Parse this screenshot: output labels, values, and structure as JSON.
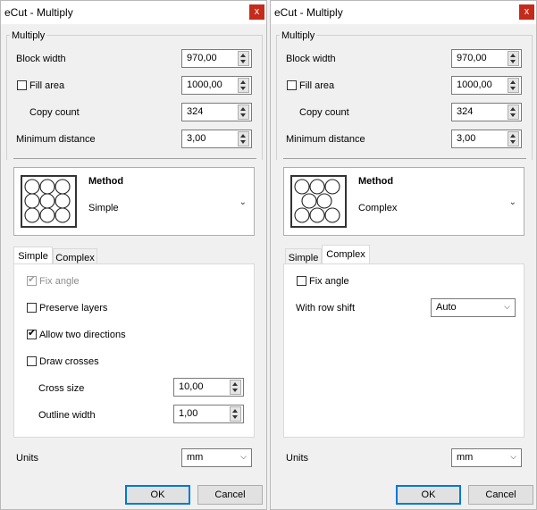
{
  "windows": [
    {
      "title": "eCut - Multiply",
      "close_label": "x",
      "group_label": "Multiply",
      "block_width_label": "Block width",
      "block_width_value": "970,00",
      "fill_area_label": "Fill area",
      "fill_area_value": "1000,00",
      "fill_area_checked": false,
      "copy_count_label": "Copy count",
      "copy_count_value": "324",
      "min_distance_label": "Minimum distance",
      "min_distance_value": "3,00",
      "method_title": "Method",
      "method_value": "Simple",
      "tabs": [
        "Simple",
        "Complex"
      ],
      "active_tab": "Simple",
      "simple_tab": {
        "fix_angle_label": "Fix angle",
        "fix_angle_checked": true,
        "fix_angle_disabled": true,
        "preserve_layers_label": "Preserve layers",
        "preserve_layers_checked": false,
        "allow_two_dir_label": "Allow two directions",
        "allow_two_dir_checked": true,
        "draw_crosses_label": "Draw crosses",
        "draw_crosses_checked": false,
        "cross_size_label": "Cross size",
        "cross_size_value": "10,00",
        "outline_width_label": "Outline width",
        "outline_width_value": "1,00"
      },
      "units_label": "Units",
      "units_value": "mm",
      "ok_label": "OK",
      "cancel_label": "Cancel"
    },
    {
      "title": "eCut - Multiply",
      "close_label": "x",
      "group_label": "Multiply",
      "block_width_label": "Block width",
      "block_width_value": "970,00",
      "fill_area_label": "Fill area",
      "fill_area_value": "1000,00",
      "fill_area_checked": false,
      "copy_count_label": "Copy count",
      "copy_count_value": "324",
      "min_distance_label": "Minimum distance",
      "min_distance_value": "3,00",
      "method_title": "Method",
      "method_value": "Complex",
      "tabs": [
        "Simple",
        "Complex"
      ],
      "active_tab": "Complex",
      "complex_tab": {
        "fix_angle_label": "Fix angle",
        "fix_angle_checked": false,
        "row_shift_label": "With row shift",
        "row_shift_value": "Auto"
      },
      "units_label": "Units",
      "units_value": "mm",
      "ok_label": "OK",
      "cancel_label": "Cancel"
    }
  ],
  "colors": {
    "close_button": "#c42b1c",
    "default_button_border": "#0078d7",
    "window_bg": "#f0f0f0"
  },
  "icons": [
    "close-icon",
    "spin-up-icon",
    "spin-down-icon",
    "chevron-down-icon",
    "circle-grid-icon",
    "checkmark-icon"
  ]
}
